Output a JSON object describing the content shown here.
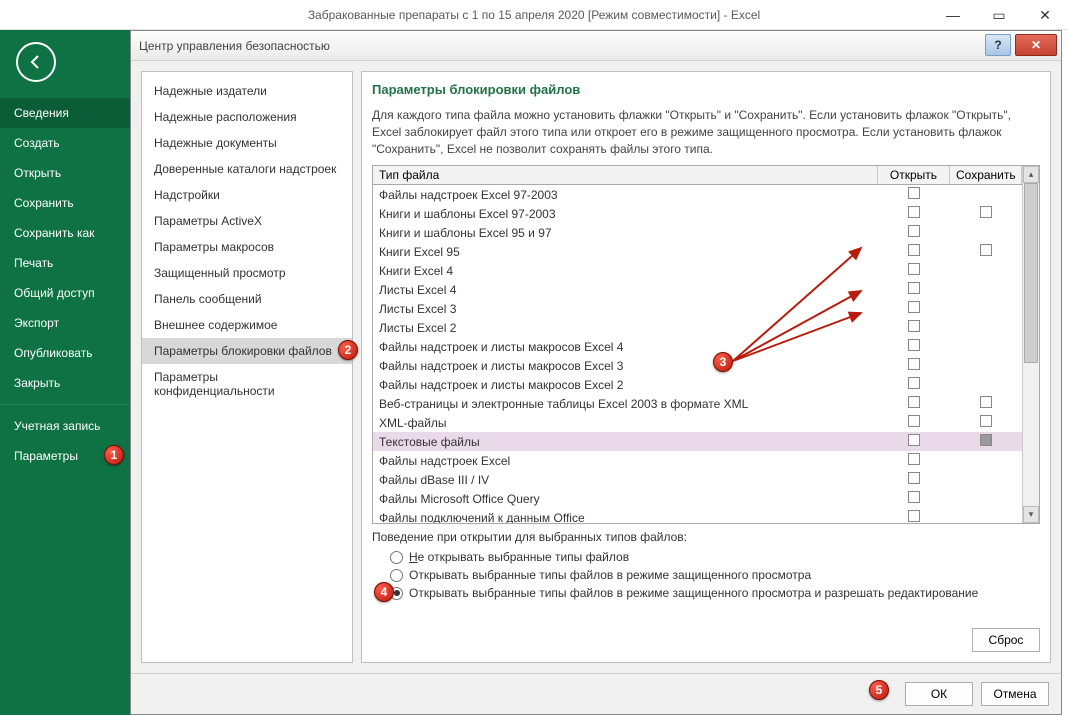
{
  "window": {
    "title": "Забракованные препараты с 1 по 15 апреля 2020  [Режим совместимости] - Excel"
  },
  "sidebar": {
    "items": [
      {
        "label": "Сведения",
        "selected": true
      },
      {
        "label": "Создать"
      },
      {
        "label": "Открыть"
      },
      {
        "label": "Сохранить"
      },
      {
        "label": "Сохранить как"
      },
      {
        "label": "Печать"
      },
      {
        "label": "Общий доступ"
      },
      {
        "label": "Экспорт"
      },
      {
        "label": "Опубликовать"
      },
      {
        "label": "Закрыть"
      }
    ],
    "account": "Учетная запись",
    "params": "Параметры"
  },
  "dialog": {
    "title": "Центр управления безопасностью",
    "left": [
      "Надежные издатели",
      "Надежные расположения",
      "Надежные документы",
      "Доверенные каталоги надстроек",
      "Надстройки",
      "Параметры ActiveX",
      "Параметры макросов",
      "Защищенный просмотр",
      "Панель сообщений",
      "Внешнее содержимое",
      "Параметры блокировки файлов",
      "Параметры конфиденциальности"
    ],
    "left_selected_index": 10,
    "content": {
      "heading": "Параметры блокировки файлов",
      "desc": "Для каждого типа файла можно установить флажки \"Открыть\" и \"Сохранить\". Если установить флажок \"Открыть\", Excel заблокирует файл этого типа или откроет его в режиме защищенного просмотра. Если установить флажок \"Сохранить\", Excel не позволит сохранять файлы этого типа.",
      "cols": {
        "type": "Тип файла",
        "open": "Открыть",
        "save": "Сохранить"
      },
      "rows": [
        {
          "name": "Файлы надстроек Excel 97-2003",
          "open": false,
          "save": null
        },
        {
          "name": "Книги и шаблоны Excel 97-2003",
          "open": false,
          "save": false
        },
        {
          "name": "Книги и шаблоны Excel 95 и 97",
          "open": false,
          "save": null
        },
        {
          "name": "Книги Excel 95",
          "open": false,
          "save": false
        },
        {
          "name": "Книги Excel 4",
          "open": false,
          "save": null
        },
        {
          "name": "Листы Excel 4",
          "open": false,
          "save": null
        },
        {
          "name": "Листы Excel 3",
          "open": false,
          "save": null
        },
        {
          "name": "Листы Excel 2",
          "open": false,
          "save": null
        },
        {
          "name": "Файлы надстроек и листы макросов Excel 4",
          "open": false,
          "save": null
        },
        {
          "name": "Файлы надстроек и листы макросов Excel 3",
          "open": false,
          "save": null
        },
        {
          "name": "Файлы надстроек и листы макросов Excel 2",
          "open": false,
          "save": null
        },
        {
          "name": "Веб-страницы и электронные таблицы Excel 2003 в формате XML",
          "open": false,
          "save": false
        },
        {
          "name": "XML-файлы",
          "open": false,
          "save": false
        },
        {
          "name": "Текстовые файлы",
          "open": false,
          "save": "gray",
          "hl": true
        },
        {
          "name": "Файлы надстроек Excel",
          "open": false,
          "save": null
        },
        {
          "name": "Файлы dBase III / IV",
          "open": false,
          "save": null
        },
        {
          "name": "Файлы Microsoft Office Query",
          "open": false,
          "save": null
        },
        {
          "name": "Файлы подключений к данным Office",
          "open": false,
          "save": null
        }
      ],
      "behavior_head": "Поведение при открытии для выбранных типов файлов:",
      "radios": [
        {
          "label_pre": "Н",
          "label": "е открывать выбранные типы файлов"
        },
        {
          "label_pre": "",
          "label": "Открывать выбранные типы файлов в режиме защищенного просмотра"
        },
        {
          "label_pre": "",
          "label": "Открывать выбранные типы файлов в режиме защищенного просмотра и разрешать редактирование",
          "selected": true
        }
      ],
      "reset": "Сброс"
    },
    "ok": "ОК",
    "cancel": "Отмена"
  },
  "badges": {
    "1": "1",
    "2": "2",
    "3": "3",
    "4": "4",
    "5": "5"
  }
}
